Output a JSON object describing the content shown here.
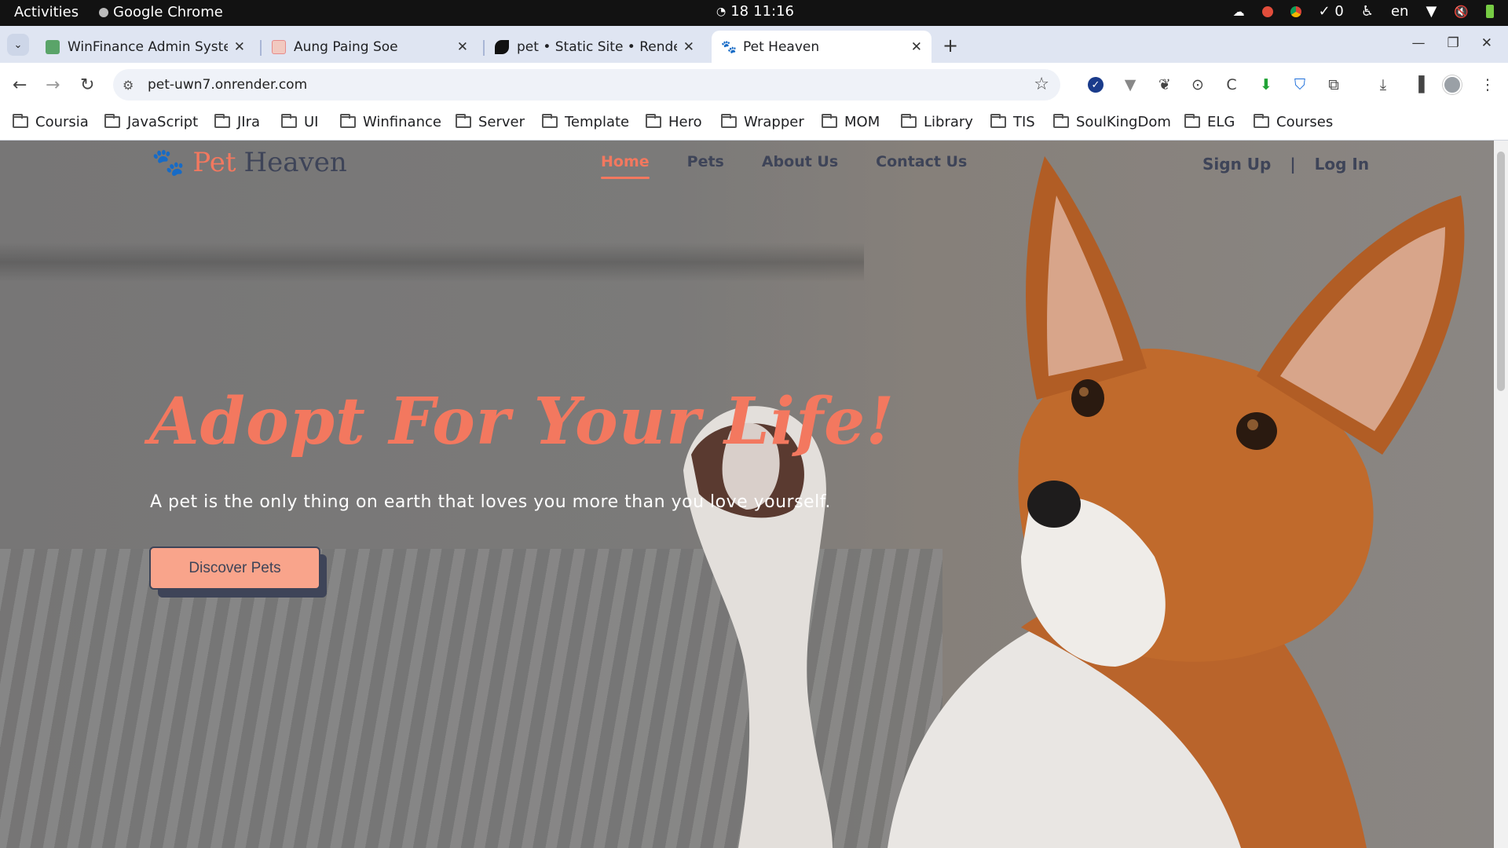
{
  "system_bar": {
    "activities": "Activities",
    "app_name": "Google Chrome",
    "date": "18",
    "time": "11:16",
    "tasks_count": "0",
    "language": "en"
  },
  "tabs": [
    {
      "title": "WinFinance Admin System",
      "favicon": "winfinance-icon",
      "color": "#5aa469"
    },
    {
      "title": "Aung Paing Soe",
      "favicon": "profile-icon",
      "color": "#e78a8a"
    },
    {
      "title": "pet • Static Site • Render",
      "favicon": "render-icon",
      "color": "#111111"
    },
    {
      "title": "Pet Heaven",
      "favicon": "paw-icon",
      "color": "#f3785f",
      "active": true
    }
  ],
  "address_bar": {
    "url": "pet-uwn7.onrender.com"
  },
  "bookmarks": [
    "Coursia",
    "JavaScript",
    "JIra",
    "UI",
    "Winfinance",
    "Server",
    "Template",
    "Hero",
    "Wrapper",
    "MOM",
    "Library",
    "TIS",
    "SoulKingDom",
    "ELG",
    "Courses"
  ],
  "site": {
    "logo": {
      "word1": "Pet",
      "word2": "Heaven"
    },
    "nav": [
      "Home",
      "Pets",
      "About Us",
      "Contact Us"
    ],
    "auth": {
      "signup": "Sign Up",
      "divider": "|",
      "login": "Log In"
    },
    "hero": {
      "title": "Adopt For Your Life!",
      "subtitle": "A pet is the only thing on earth that loves you more than you love yourself.",
      "cta": "Discover Pets"
    },
    "colors": {
      "accent": "#f3785f",
      "navy": "#3e4458",
      "button": "#f9a48b"
    }
  }
}
